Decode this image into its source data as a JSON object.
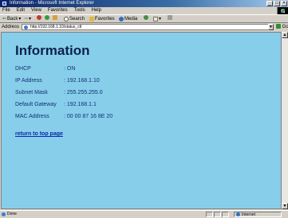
{
  "window": {
    "title": "Information - Microsoft Internet Explorer",
    "controls": [
      "_",
      "□",
      "×"
    ]
  },
  "menu": [
    "File",
    "Edit",
    "View",
    "Favorites",
    "Tools",
    "Help"
  ],
  "toolbar": {
    "back": "Back",
    "search": "Search",
    "favorites": "Favorites",
    "media": "Media"
  },
  "address": {
    "label": "Address",
    "url": "http://192.168.1.10/status_ctl",
    "go": "Go"
  },
  "page": {
    "heading": "Information",
    "rows": [
      {
        "label": "DHCP",
        "value": ": ON"
      },
      {
        "label": "IP Address",
        "value": ": 192.168.1.10"
      },
      {
        "label": "Subnet Mask",
        "value": ": 255.255.255.0"
      },
      {
        "label": "Default Gateway",
        "value": ": 192.168.1.1"
      },
      {
        "label": "MAC Address",
        "value": ": 00 00 87 16 8E 20"
      }
    ],
    "link": "return to top page"
  },
  "status": {
    "text": "Done",
    "zone": "Internet"
  },
  "colors": {
    "content_bg": "#87ceeb",
    "heading": "#0b2150",
    "link": "#0b2aa6"
  }
}
